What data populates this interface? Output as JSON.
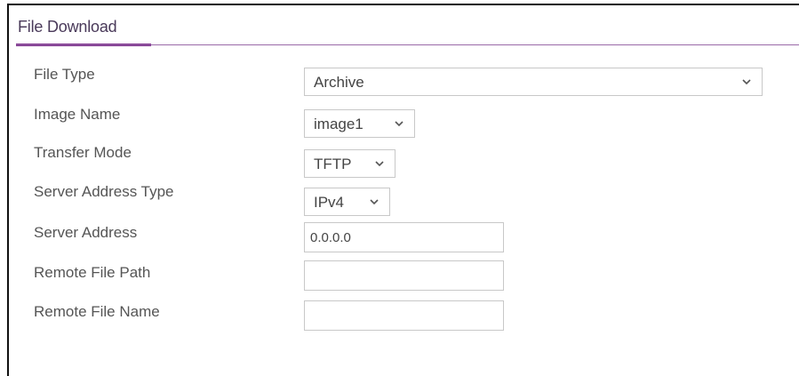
{
  "panel": {
    "title": "File Download"
  },
  "fields": {
    "file_type": {
      "label": "File Type",
      "value": "Archive"
    },
    "image_name": {
      "label": "Image Name",
      "value": "image1"
    },
    "transfer_mode": {
      "label": "Transfer Mode",
      "value": "TFTP"
    },
    "server_address_type": {
      "label": "Server Address Type",
      "value": "IPv4"
    },
    "server_address": {
      "label": "Server Address",
      "value": "0.0.0.0"
    },
    "remote_file_path": {
      "label": "Remote File Path",
      "value": ""
    },
    "remote_file_name": {
      "label": "Remote File Name",
      "value": ""
    }
  },
  "colors": {
    "accent": "#7a2a8a",
    "border": "#c8c8c8",
    "label_text": "#555555"
  },
  "icons": {
    "dropdown": "chevron-down-icon"
  }
}
